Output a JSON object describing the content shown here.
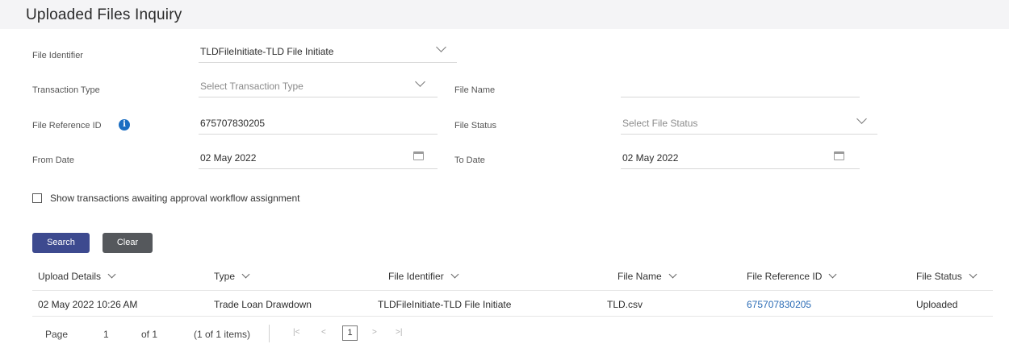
{
  "page": {
    "title": "Uploaded Files Inquiry"
  },
  "form": {
    "file_identifier": {
      "label": "File Identifier",
      "value": "TLDFileInitiate-TLD File Initiate"
    },
    "transaction_type": {
      "label": "Transaction Type",
      "placeholder": "Select Transaction Type"
    },
    "file_name": {
      "label": "File Name",
      "value": ""
    },
    "file_reference_id": {
      "label": "File Reference ID",
      "value": "675707830205",
      "info_icon": "info-icon"
    },
    "file_status": {
      "label": "File Status",
      "placeholder": "Select File Status"
    },
    "from_date": {
      "label": "From Date",
      "value": "02 May 2022"
    },
    "to_date": {
      "label": "To Date",
      "value": "02 May 2022"
    },
    "approval_checkbox": {
      "label": "Show transactions awaiting approval workflow assignment",
      "checked": false
    }
  },
  "buttons": {
    "search": "Search",
    "clear": "Clear"
  },
  "table": {
    "headers": [
      "Upload Details",
      "Type",
      "File Identifier",
      "File Name",
      "File Reference ID",
      "File Status"
    ],
    "rows": [
      [
        "02 May 2022 10:26 AM",
        "Trade Loan Drawdown",
        "TLDFileInitiate-TLD File Initiate",
        "TLD.csv",
        "675707830205",
        "Uploaded"
      ]
    ]
  },
  "pagination": {
    "page_label": "Page",
    "page_number": "1",
    "of_label": "of 1",
    "items_summary": "(1 of 1 items)",
    "current_page": "1",
    "first_icon": "first-page-icon",
    "prev_icon": "prev-page-icon",
    "next_icon": "next-page-icon",
    "last_icon": "last-page-icon"
  },
  "colors": {
    "primary_button": "#3d4a8f",
    "secondary_button": "#55585c",
    "link": "#2a6bb5",
    "info": "#1b6ec2"
  }
}
